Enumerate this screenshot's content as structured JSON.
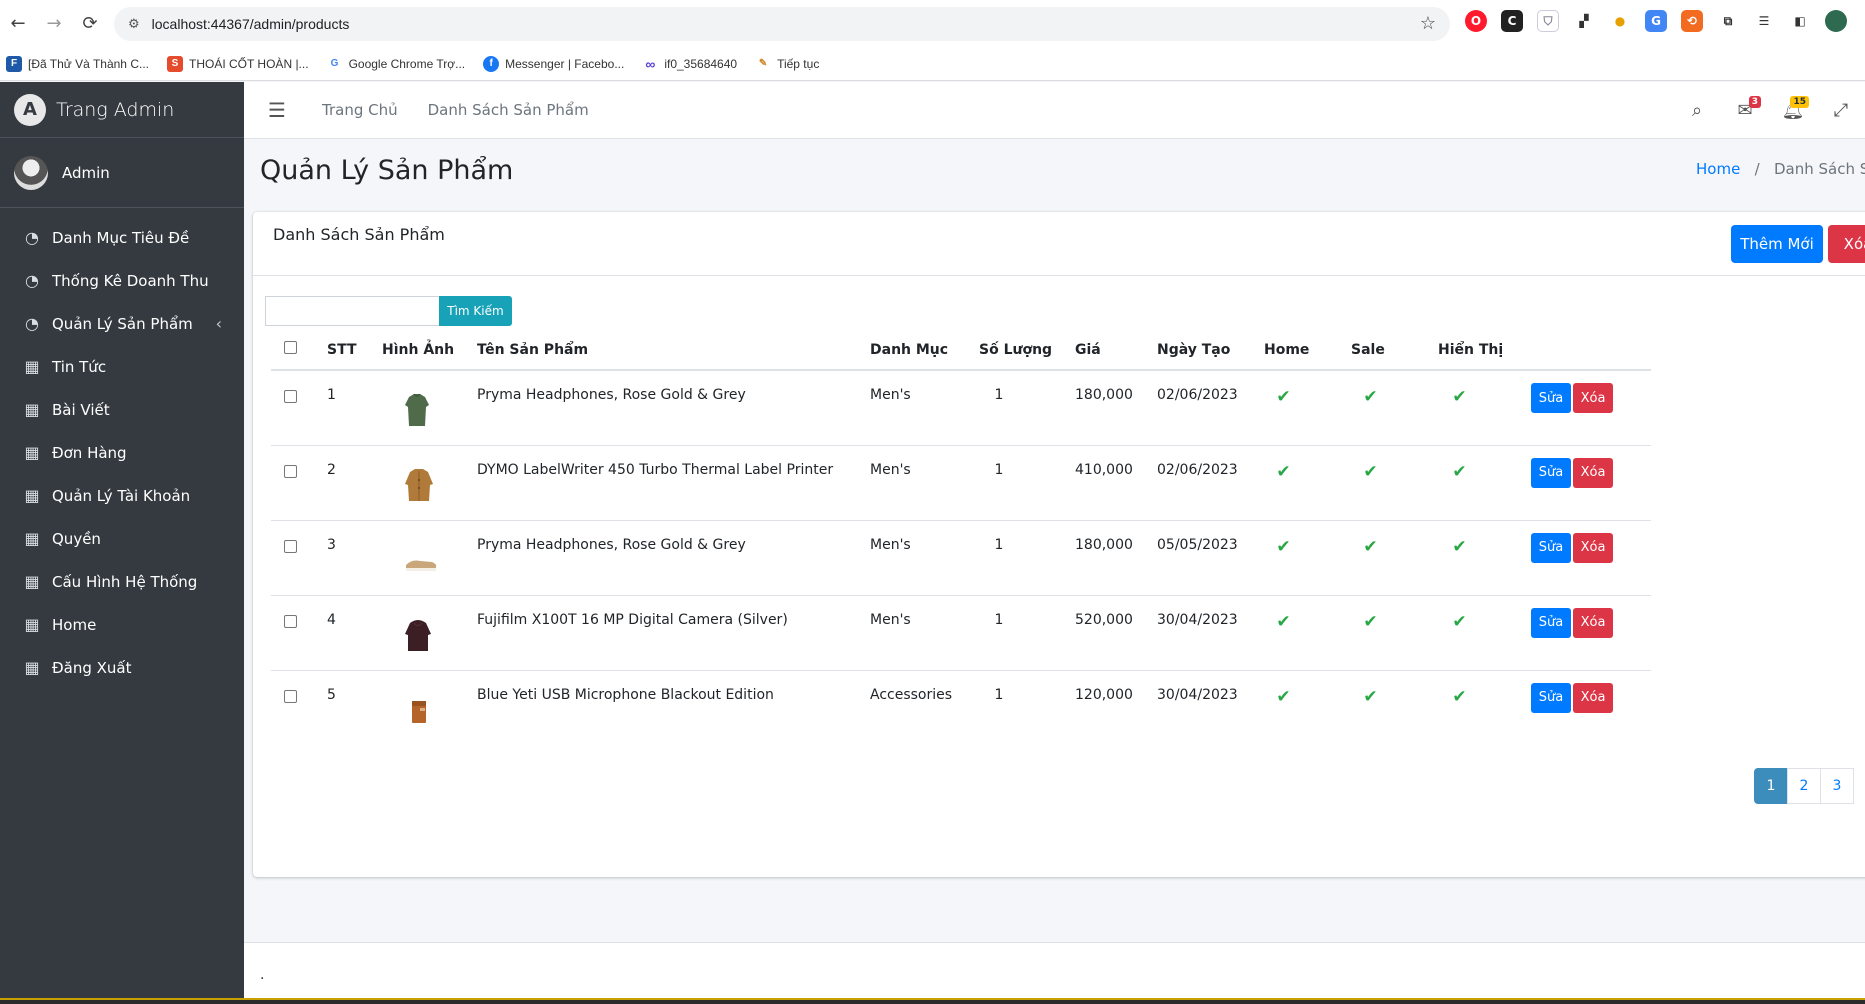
{
  "browser": {
    "url": "localhost:44367/admin/products",
    "bookmarks": [
      {
        "label": "[Đã Thử Và Thành C...",
        "color": "#1e5aa8",
        "glyph": "F"
      },
      {
        "label": "THOÁI CỐT HOÀN |...",
        "color": "#e44c2c",
        "glyph": "S"
      },
      {
        "label": "Google Chrome Trợ...",
        "color": "#4285f4",
        "glyph": "G"
      },
      {
        "label": "Messenger | Facebo...",
        "color": "#1877f2",
        "glyph": "f"
      },
      {
        "label": "if0_35684640",
        "color": "#5b3fd6",
        "glyph": "∞"
      },
      {
        "label": "Tiếp tục",
        "color": "#d08a2f",
        "glyph": "✎"
      }
    ]
  },
  "sidebar": {
    "brand": "Trang Admin",
    "user": "Admin",
    "items": [
      {
        "label": "Danh Mục Tiêu Đề",
        "icon": "dashboard-icon"
      },
      {
        "label": "Thống Kê Doanh Thu",
        "icon": "dashboard-icon"
      },
      {
        "label": "Quản Lý Sản Phẩm",
        "icon": "dashboard-icon"
      },
      {
        "label": "Tin Tức",
        "icon": "grid-icon"
      },
      {
        "label": "Bài Viết",
        "icon": "grid-icon"
      },
      {
        "label": "Đơn Hàng",
        "icon": "grid-icon"
      },
      {
        "label": "Quản Lý Tài Khoản",
        "icon": "grid-icon"
      },
      {
        "label": "Quyền",
        "icon": "grid-icon"
      },
      {
        "label": "Cấu Hình Hệ Thống",
        "icon": "grid-icon"
      },
      {
        "label": "Home",
        "icon": "grid-icon"
      },
      {
        "label": "Đăng Xuất",
        "icon": "grid-icon"
      }
    ]
  },
  "navbar": {
    "links": [
      "Trang Chủ",
      "Danh Sách Sản Phẩm"
    ],
    "messages_badge": "3",
    "notifications_badge": "15"
  },
  "header": {
    "title": "Quản Lý Sản Phẩm",
    "breadcrumb_home": "Home",
    "breadcrumb_current": "Danh Sách Sản P"
  },
  "card": {
    "title": "Danh Sách Sản Phẩm",
    "add_label": "Thêm Mới",
    "delete_label": "Xóa",
    "search_label": "Tìm Kiếm",
    "search_value": ""
  },
  "table": {
    "columns": [
      "STT",
      "Hình Ảnh",
      "Tên Sản Phẩm",
      "Danh Mục",
      "Số Lượng",
      "Giá",
      "Ngày Tạo",
      "Home",
      "Sale",
      "Hiển Thị"
    ],
    "edit_label": "Sửa",
    "delete_label": "Xóa",
    "rows": [
      {
        "stt": "1",
        "image": "green-sweater",
        "name": "Pryma Headphones, Rose Gold & Grey",
        "category": "Men's",
        "qty": "1",
        "price": "180,000",
        "date": "02/06/2023",
        "home": true,
        "sale": true,
        "visible": true
      },
      {
        "stt": "2",
        "image": "tan-jacket",
        "name": "DYMO LabelWriter 450 Turbo Thermal Label Printer",
        "category": "Men's",
        "qty": "1",
        "price": "410,000",
        "date": "02/06/2023",
        "home": true,
        "sale": true,
        "visible": true
      },
      {
        "stt": "3",
        "image": "sneaker",
        "name": "Pryma Headphones, Rose Gold & Grey",
        "category": "Men's",
        "qty": "1",
        "price": "180,000",
        "date": "05/05/2023",
        "home": true,
        "sale": true,
        "visible": true
      },
      {
        "stt": "4",
        "image": "dark-hoodie",
        "name": "Fujifilm X100T 16 MP Digital Camera (Silver)",
        "category": "Men's",
        "qty": "1",
        "price": "520,000",
        "date": "30/04/2023",
        "home": true,
        "sale": true,
        "visible": true
      },
      {
        "stt": "5",
        "image": "brown-wallet",
        "name": "Blue Yeti USB Microphone Blackout Edition",
        "category": "Accessories",
        "qty": "1",
        "price": "120,000",
        "date": "30/04/2023",
        "home": true,
        "sale": true,
        "visible": true
      }
    ]
  },
  "pagination": {
    "pages": [
      "1",
      "2",
      "3"
    ],
    "current": "1"
  },
  "footer": {
    "text": "."
  }
}
